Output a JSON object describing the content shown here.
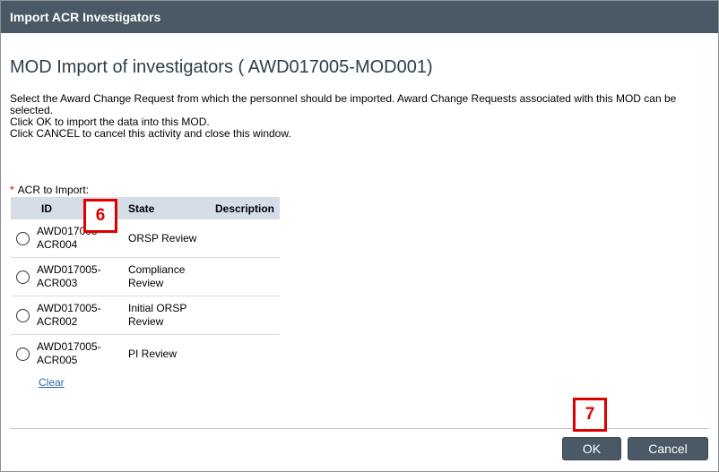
{
  "window": {
    "title": "Import ACR Investigators"
  },
  "main": {
    "heading": "MOD Import of investigators ( AWD017005-MOD001)",
    "instructions": [
      "Select the Award Change Request from which the personnel should be imported.  Award Change Requests associated with this MOD can be selected.",
      "Click OK to import the data into this MOD.",
      "Click CANCEL to cancel this activity and close this window."
    ],
    "field": {
      "required_marker": "*",
      "label": "ACR to Import:"
    },
    "table": {
      "columns": [
        "ID",
        "State",
        "Description"
      ],
      "rows": [
        {
          "id": "AWD017005-ACR004",
          "state": "ORSP Review",
          "description": ""
        },
        {
          "id": "AWD017005-ACR003",
          "state": "Compliance Review",
          "description": ""
        },
        {
          "id": "AWD017005-ACR002",
          "state": "Initial ORSP Review",
          "description": ""
        },
        {
          "id": "AWD017005-ACR005",
          "state": "PI Review",
          "description": ""
        }
      ]
    },
    "clear_label": "Clear"
  },
  "footer": {
    "ok_label": "OK",
    "cancel_label": "Cancel"
  },
  "annotations": {
    "callout_6": "6",
    "callout_7": "7"
  },
  "colors": {
    "titlebar": "#4b5966",
    "table_header": "#d4dde8",
    "link": "#2b6aa8",
    "callout": "#e00000"
  }
}
